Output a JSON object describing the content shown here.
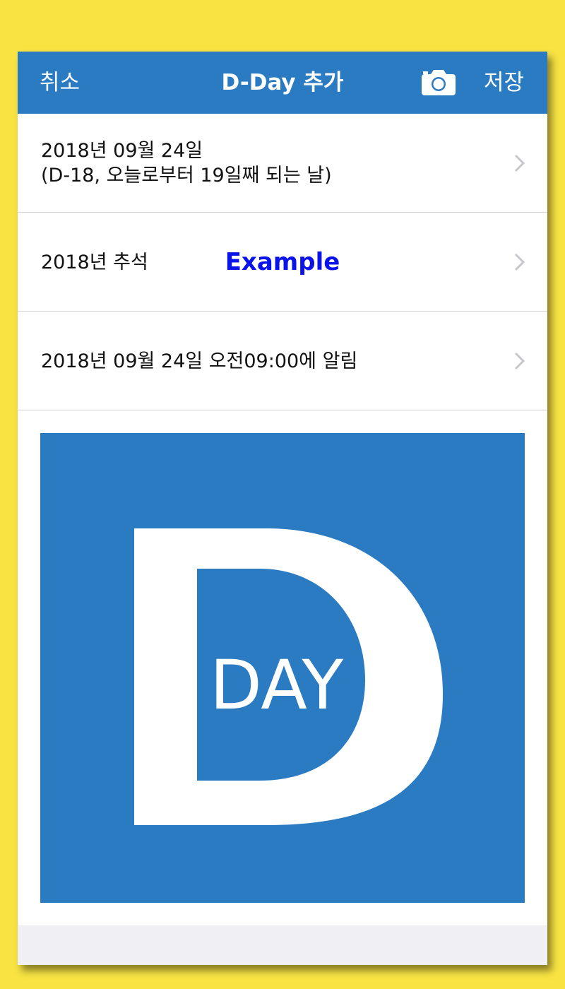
{
  "navbar": {
    "cancel_label": "취소",
    "title": "D-Day 추가",
    "camera_icon": "camera-icon",
    "save_label": "저장"
  },
  "rows": [
    {
      "line1": "2018년 09월 24일",
      "line2": "(D-18, 오늘로부터 19일째 되는 날)"
    },
    {
      "line1": "2018년 추석",
      "tag": "Example"
    },
    {
      "line1": "2018년 09월 24일 오전09:00에 알림"
    }
  ],
  "logo": {
    "text": "DAY",
    "icon": "d-day-logo"
  },
  "colors": {
    "background": "#f8e343",
    "accent": "#2b7bc3",
    "example_text": "#0a14e8",
    "separator": "#d2d2d6",
    "footer": "#efeff4"
  }
}
